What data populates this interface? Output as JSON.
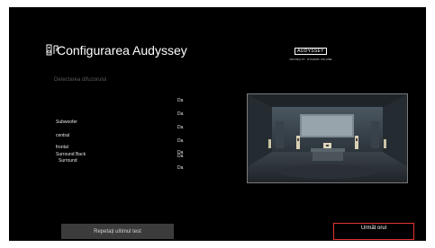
{
  "header": {
    "icon": "audyssey-setup-icon",
    "title": "Configurarea Audyssey"
  },
  "brand": {
    "logo_text": "AUDYSSEY",
    "tagline": "MULTEQ XT · DYNAMIC VOLUME"
  },
  "step": {
    "label": "Detectarea difuzorului"
  },
  "speakers": [
    {
      "name": "Subwoofer",
      "value": "Da"
    },
    {
      "name": "central",
      "value": "Da"
    },
    {
      "name": "frontal",
      "value": "Da"
    },
    {
      "name": "Surround Back",
      "value": "Da"
    },
    {
      "name": "Surround",
      "value": "Da"
    }
  ],
  "extra_values": [
    "Da",
    "Da"
  ],
  "illustration": "room-speaker-layout-diagram",
  "buttons": {
    "repeat": "Repetați ultimul test",
    "next": "Următ orul"
  },
  "colors": {
    "background": "#000000",
    "focus_border": "#e33434",
    "button_bg": "#3c3c3c"
  }
}
